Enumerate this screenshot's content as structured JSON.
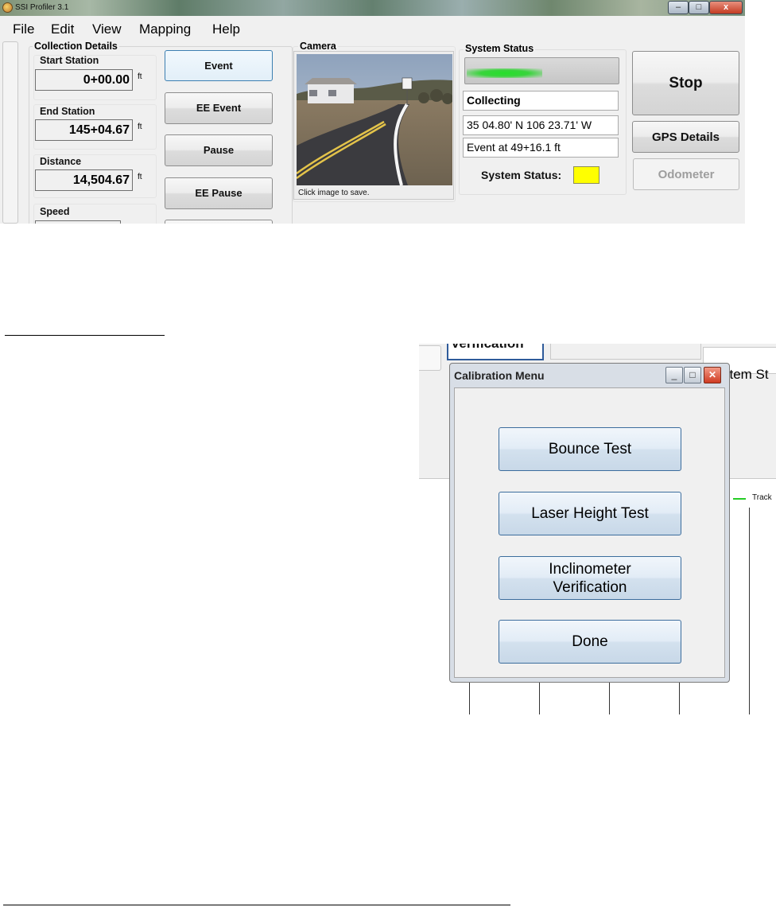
{
  "main_window": {
    "title": "SSI Profiler 3.1",
    "menu": [
      "File",
      "Edit",
      "View",
      "Mapping",
      "Help"
    ],
    "collection_details": {
      "group_title": "Collection Details",
      "start_station": {
        "label": "Start Station",
        "value": "0+00.00",
        "unit": "ft"
      },
      "end_station": {
        "label": "End Station",
        "value": "145+04.67",
        "unit": "ft"
      },
      "distance": {
        "label": "Distance",
        "value": "14,504.67",
        "unit": "ft"
      },
      "speed": {
        "label": "Speed"
      }
    },
    "action_buttons": [
      "Event",
      "EE Event",
      "Pause",
      "EE Pause"
    ],
    "camera": {
      "group_title": "Camera",
      "caption": "Click image to save."
    },
    "system_status": {
      "group_title": "System Status",
      "progress_fraction": 0.5,
      "state": "Collecting",
      "gps_position": "35 04.80' N 106 23.71' W",
      "last_event": "Event at 49+16.1 ft",
      "indicator_label": "System Status:",
      "indicator_color": "#ffff00"
    },
    "right_buttons": {
      "stop": "Stop",
      "gps_details": "GPS Details",
      "odometer": "Odometer"
    }
  },
  "calibration_screenshot": {
    "background_tab": "Verification",
    "background_status_text": "stem St",
    "track_label": "Track",
    "track_color": "#25cc25",
    "dialog": {
      "title": "Calibration Menu",
      "buttons": {
        "bounce_test": "Bounce Test",
        "laser_height_test": "Laser Height Test",
        "inclinometer_line1": "Inclinometer",
        "inclinometer_line2": "Verification",
        "done": "Done"
      }
    }
  }
}
